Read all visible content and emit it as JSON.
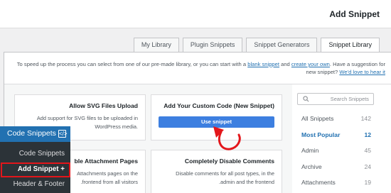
{
  "header": {
    "title": "Add Snippet"
  },
  "tabs": [
    {
      "label": "My Library",
      "active": false
    },
    {
      "label": "Plugin Snippets",
      "active": false
    },
    {
      "label": "Snippet Generators",
      "active": false
    },
    {
      "label": "Snippet Library",
      "active": true
    }
  ],
  "intro": {
    "text_before": "To speed up the process you can select from one of our pre-made library, or you can start with a ",
    "blank_link": "blank snippet",
    "text_middle": " and ",
    "create_link": "create your own",
    "text_after": ". Have a suggestion for new snippet? ",
    "love_link": "We'd love to hear it"
  },
  "cards": [
    {
      "title": "Allow SVG Files Upload",
      "desc_line1": "Add support for SVG files to be uploaded in",
      "desc_line2": "WordPress media."
    },
    {
      "title": "Add Your Custom Code (New Snippet)",
      "button": "Use snippet"
    },
    {
      "title": "Disable Attachment Pages",
      "title_visible": "ble Attachment Pages",
      "desc_line1": "Attachments pages on the",
      "desc_line2": ".frontend from all visitors"
    },
    {
      "title": "Completely Disable Comments",
      "desc_line1": "Disable comments for all post types, in the",
      "desc_line2": ".admin and the frontend"
    }
  ],
  "search": {
    "placeholder": "Search Snippets"
  },
  "categories": [
    {
      "label": "All Snippets",
      "count": "142",
      "active": false
    },
    {
      "label": "Most Popular",
      "count": "12",
      "active": true
    },
    {
      "label": "Admin",
      "count": "45",
      "active": false
    },
    {
      "label": "Archive",
      "count": "24",
      "active": false
    },
    {
      "label": "Attachments",
      "count": "19",
      "active": false
    }
  ],
  "admin_menu": {
    "title": "Code Snippets",
    "items": [
      {
        "label": "Code Snippets"
      },
      {
        "label": "Add Snippet +"
      },
      {
        "label": "Header & Footer"
      }
    ]
  },
  "colors": {
    "accent": "#2271b1",
    "button": "#3d7fe0",
    "annotation": "#e3161b"
  }
}
